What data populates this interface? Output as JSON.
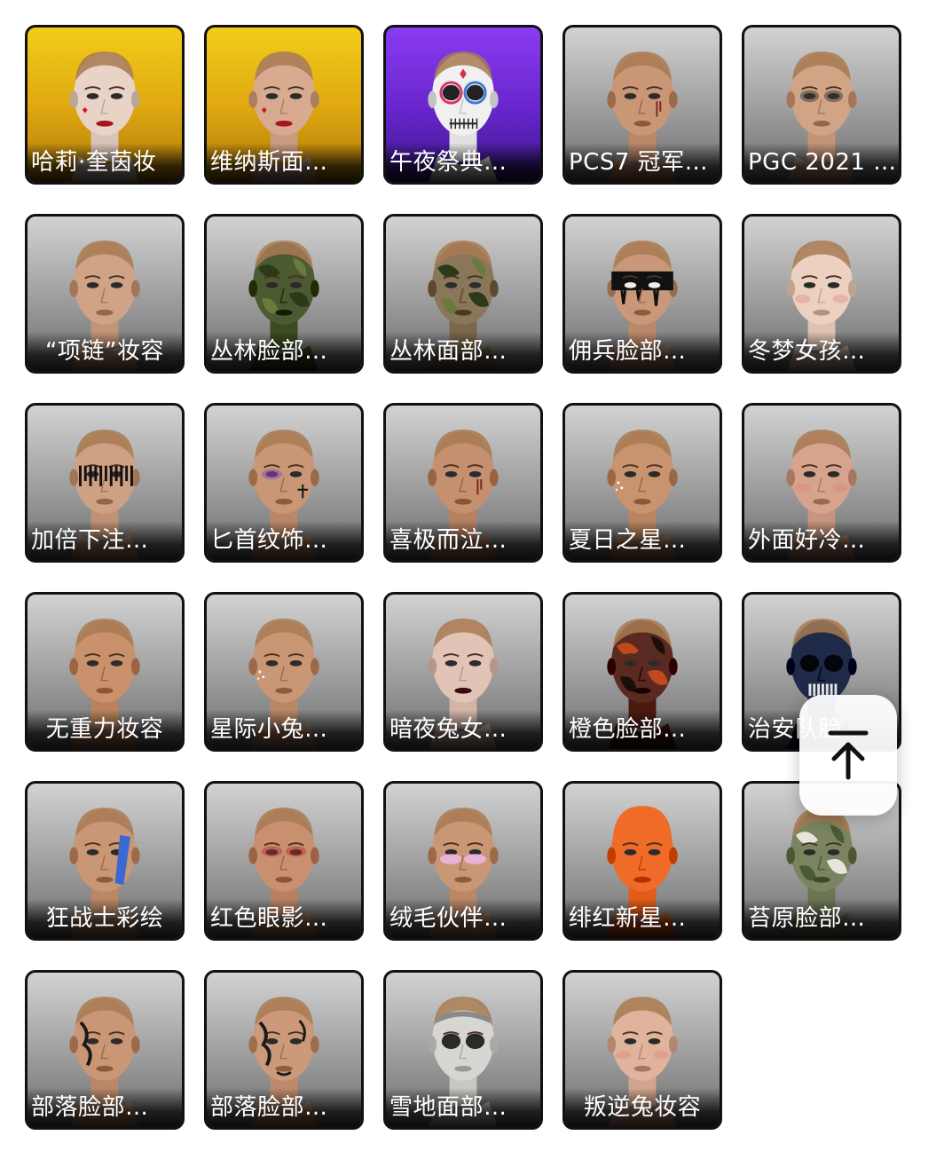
{
  "items": [
    {
      "label": "哈莉·奎茵妆",
      "bg": "gold",
      "skin": "#e9d2c6",
      "paint": "harley",
      "center": false
    },
    {
      "label": "维纳斯面…",
      "bg": "gold",
      "skin": "#d8ab90",
      "paint": "heart",
      "center": false
    },
    {
      "label": "午夜祭典…",
      "bg": "purple",
      "skin": "#f0f0f0",
      "paint": "skull-white",
      "center": false
    },
    {
      "label": "PCS7 冠军…",
      "bg": "gray",
      "skin": "#c99676",
      "paint": "drips",
      "center": false
    },
    {
      "label": "PGC 2021 …",
      "bg": "gray",
      "skin": "#d2a486",
      "paint": "smoky",
      "center": false
    },
    {
      "label": "“项链”妆容",
      "bg": "gray",
      "skin": "#d0a286",
      "paint": "necklace",
      "center": true
    },
    {
      "label": "丛林脸部…",
      "bg": "gray",
      "skin": "#4b5a30",
      "paint": "camo-dark",
      "center": false
    },
    {
      "label": "丛林面部…",
      "bg": "gray",
      "skin": "#8a7658",
      "paint": "camo-male",
      "center": false
    },
    {
      "label": "佣兵脸部…",
      "bg": "gray",
      "skin": "#c99878",
      "paint": "black-band",
      "center": false
    },
    {
      "label": "冬梦女孩…",
      "bg": "gray",
      "skin": "#ecd0c0",
      "paint": "freckles",
      "center": false
    },
    {
      "label": "加倍下注…",
      "bg": "gray",
      "skin": "#cfa184",
      "paint": "barcode",
      "center": false
    },
    {
      "label": "匕首纹饰…",
      "bg": "gray",
      "skin": "#c99676",
      "paint": "dagger",
      "center": false
    },
    {
      "label": "喜极而泣…",
      "bg": "gray",
      "skin": "#c49070",
      "paint": "tears",
      "center": false
    },
    {
      "label": "夏日之星…",
      "bg": "gray",
      "skin": "#c8946f",
      "paint": "star",
      "center": false
    },
    {
      "label": "外面好冷…",
      "bg": "gray",
      "skin": "#d6a48c",
      "paint": "blush",
      "center": false
    },
    {
      "label": "无重力妆容",
      "bg": "gray",
      "skin": "#c9916c",
      "paint": "plain",
      "center": true
    },
    {
      "label": "星际小兔…",
      "bg": "gray",
      "skin": "#c99676",
      "paint": "glitter",
      "center": false
    },
    {
      "label": "暗夜兔女…",
      "bg": "gray",
      "skin": "#e2c4b6",
      "paint": "dark-lips",
      "center": false
    },
    {
      "label": "橙色脸部…",
      "bg": "gray",
      "skin": "#5a2a20",
      "paint": "orange-camo",
      "center": false
    },
    {
      "label": "治安队脸…",
      "bg": "gray",
      "skin": "#1f2a48",
      "paint": "blue-skull",
      "center": false
    },
    {
      "label": "狂战士彩绘",
      "bg": "gray",
      "skin": "#c99676",
      "paint": "blue-stripe",
      "center": true
    },
    {
      "label": "红色眼影…",
      "bg": "gray",
      "skin": "#c89070",
      "paint": "red-eyes",
      "center": false
    },
    {
      "label": "绒毛伙伴…",
      "bg": "gray",
      "skin": "#c99676",
      "paint": "pink-glow",
      "center": false
    },
    {
      "label": "绯红新星…",
      "bg": "gray",
      "skin": "#f06a28",
      "paint": "orange-full",
      "center": false
    },
    {
      "label": "苔原脸部…",
      "bg": "gray",
      "skin": "#7a8460",
      "paint": "tundra",
      "center": false
    },
    {
      "label": "部落脸部…",
      "bg": "gray",
      "skin": "#c99676",
      "paint": "tribal",
      "center": false
    },
    {
      "label": "部落脸部…",
      "bg": "gray",
      "skin": "#cc9a7a",
      "paint": "tribal2",
      "center": false
    },
    {
      "label": "雪地面部…",
      "bg": "gray",
      "skin": "#d8d6d2",
      "paint": "snow",
      "center": false
    },
    {
      "label": "叛逆兔妆容",
      "bg": "gray",
      "skin": "#e0b49c",
      "paint": "rebel",
      "center": true
    }
  ],
  "scroll_top": {
    "icon": "arrow-up-to-top-icon"
  }
}
